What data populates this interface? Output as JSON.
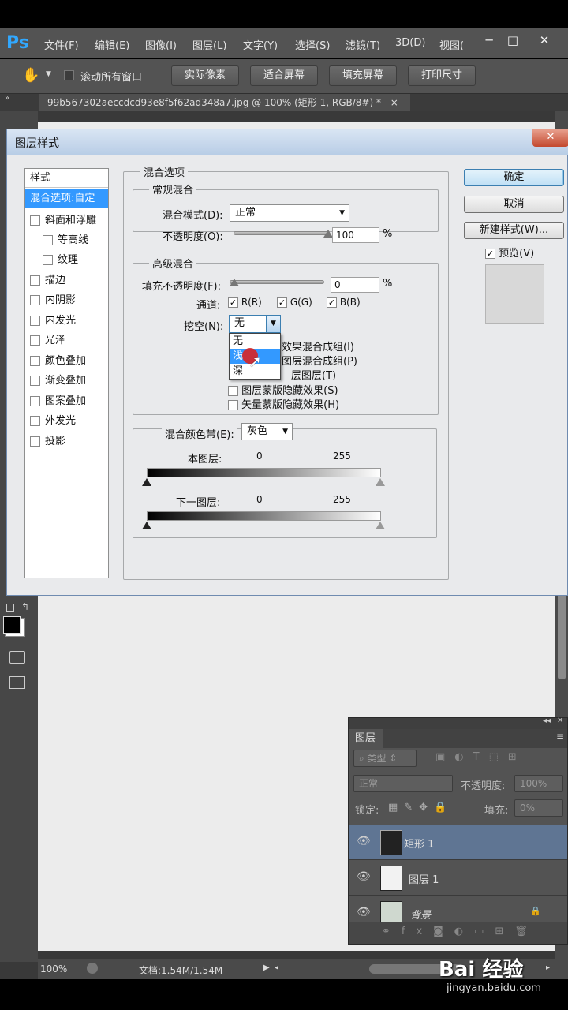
{
  "app": {
    "logo": "Ps",
    "menus": [
      "文件(F)",
      "编辑(E)",
      "图像(I)",
      "图层(L)",
      "文字(Y)",
      "选择(S)",
      "滤镜(T)",
      "3D(D)",
      "视图("
    ],
    "win_minimize": "─",
    "win_restore": "□",
    "win_close": "✕"
  },
  "options": {
    "scroll_all_label": "滚动所有窗口",
    "buttons": [
      "实际像素",
      "适合屏幕",
      "填充屏幕",
      "打印尺寸"
    ]
  },
  "doc_tab": {
    "title": "99b567302aeccdcd93e8f5f62ad348a7.jpg @ 100% (矩形 1, RGB/8#) *",
    "close": "×"
  },
  "dialog": {
    "title": "图层样式",
    "close": "✕",
    "styles_header": "样式",
    "styles": [
      "混合选项:自定",
      "斜面和浮雕",
      "等高线",
      "纹理",
      "描边",
      "内阴影",
      "内发光",
      "光泽",
      "颜色叠加",
      "渐变叠加",
      "图案叠加",
      "外发光",
      "投影"
    ],
    "blend_options_title": "混合选项",
    "general_blending": "常规混合",
    "blend_mode_label": "混合模式(D):",
    "blend_mode_value": "正常",
    "opacity_label": "不透明度(O):",
    "opacity_value": "100",
    "opacity_level": 1.0,
    "pct": "%",
    "advanced_blending": "高级混合",
    "fill_opacity_label": "填充不透明度(F):",
    "fill_opacity_value": "0",
    "fill_opacity_level": 0.0,
    "channels_label": "通道:",
    "channels": [
      "R(R)",
      "G(G)",
      "B(B)"
    ],
    "knockout_label": "挖空(N):",
    "knockout_value": "无",
    "knockout_options": [
      "无",
      "浅",
      "深"
    ],
    "adv_options": [
      "效果混合成组(I)",
      "图层混合成组(P)",
      "层图层(T)",
      "图层蒙版隐藏效果(S)",
      "矢量蒙版隐藏效果(H)"
    ],
    "blend_if_label": "混合颜色带(E):",
    "blend_if_value": "灰色",
    "this_layer_label": "本图层:",
    "underlying_label": "下一图层:",
    "range_min": "0",
    "range_max": "255",
    "ok": "确定",
    "cancel": "取消",
    "new_style": "新建样式(W)...",
    "preview": "预览(V)"
  },
  "layers_panel": {
    "tab": "图层",
    "filter": "类型",
    "blend": "正常",
    "opacity_label": "不透明度:",
    "opacity": "100%",
    "lock_label": "锁定:",
    "fill_label": "填充:",
    "fill": "0%",
    "layers": [
      "矩形 1",
      "图层 1",
      "背景"
    ]
  },
  "status": {
    "zoom": "100%",
    "doc": "文档:1.54M/1.54M"
  },
  "watermark": {
    "logo": "Bai 经验",
    "url": "jingyan.baidu.com"
  }
}
